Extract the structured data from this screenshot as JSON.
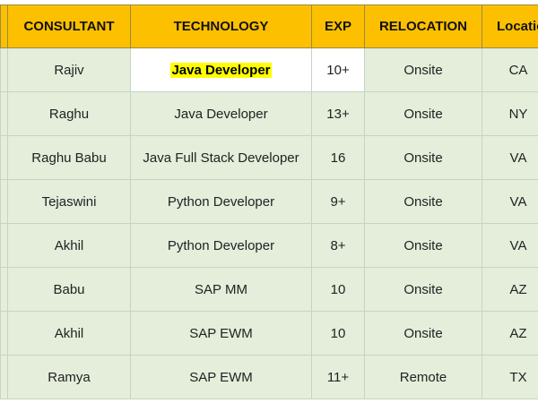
{
  "columns": [
    "CONSULTANT",
    "TECHNOLOGY",
    "EXP",
    "RELOCATION",
    "Locatio"
  ],
  "rows": [
    {
      "consultant": "Rajiv",
      "technology": "Java Developer",
      "exp": "10+",
      "relocation": "Onsite",
      "location": "CA"
    },
    {
      "consultant": "Raghu",
      "technology": "Java Developer",
      "exp": "13+",
      "relocation": "Onsite",
      "location": "NY"
    },
    {
      "consultant": "Raghu Babu",
      "technology": "Java Full Stack Developer",
      "exp": "16",
      "relocation": "Onsite",
      "location": "VA"
    },
    {
      "consultant": "Tejaswini",
      "technology": "Python Developer",
      "exp": "9+",
      "relocation": "Onsite",
      "location": "VA"
    },
    {
      "consultant": "Akhil",
      "technology": "Python Developer",
      "exp": "8+",
      "relocation": "Onsite",
      "location": "VA"
    },
    {
      "consultant": "Babu",
      "technology": "SAP MM",
      "exp": "10",
      "relocation": "Onsite",
      "location": "AZ"
    },
    {
      "consultant": "Akhil",
      "technology": "SAP EWM",
      "exp": "10",
      "relocation": "Onsite",
      "location": "AZ"
    },
    {
      "consultant": "Ramya",
      "technology": "SAP EWM",
      "exp": "11+",
      "relocation": "Remote",
      "location": "TX"
    }
  ],
  "colors": {
    "header_bg": "#fdc000",
    "row_bg": "#e4eedb",
    "highlight": "#ffff00"
  }
}
